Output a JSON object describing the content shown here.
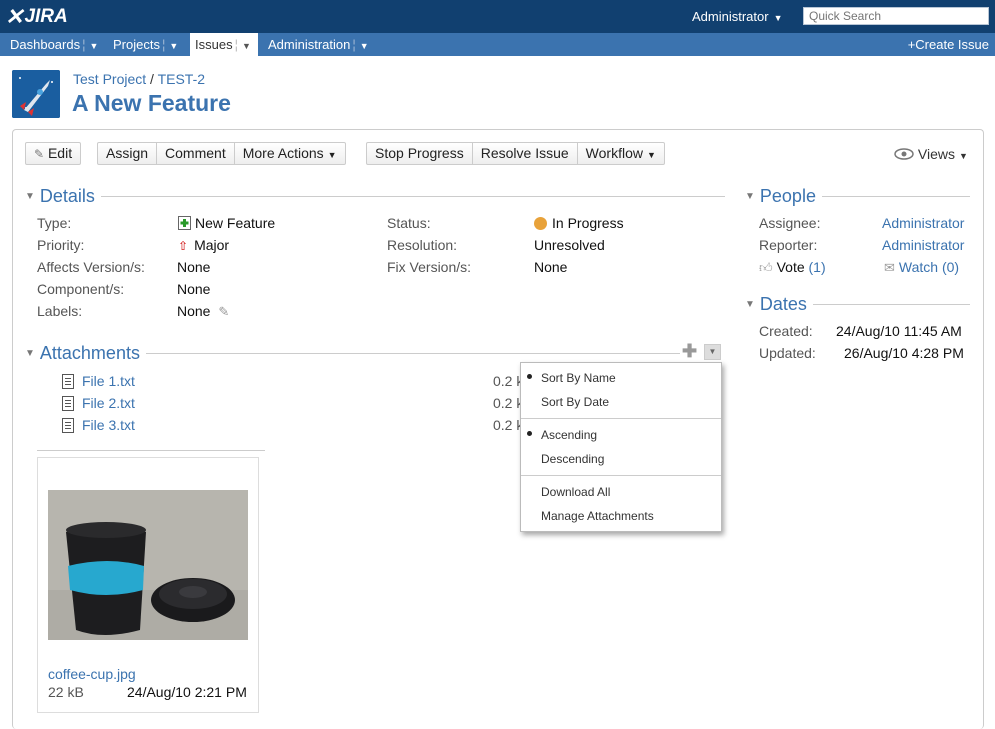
{
  "header": {
    "logo_text": "JIRA",
    "user_menu": "Administrator",
    "search_placeholder": "Quick Search"
  },
  "nav": {
    "items": [
      {
        "label": "Dashboards"
      },
      {
        "label": "Projects"
      },
      {
        "label": "Issues"
      },
      {
        "label": "Administration"
      }
    ],
    "create_issue": "Create Issue"
  },
  "issue": {
    "project": "Test Project",
    "key": "TEST-2",
    "title": "A New Feature"
  },
  "toolbar": {
    "edit": "Edit",
    "assign": "Assign",
    "comment": "Comment",
    "more_actions": "More Actions",
    "stop_progress": "Stop Progress",
    "resolve_issue": "Resolve Issue",
    "workflow": "Workflow",
    "views": "Views"
  },
  "details": {
    "title": "Details",
    "type_label": "Type:",
    "type_value": "New Feature",
    "priority_label": "Priority:",
    "priority_value": "Major",
    "affects_label": "Affects Version/s:",
    "affects_value": "None",
    "components_label": "Component/s:",
    "components_value": "None",
    "labels_label": "Labels:",
    "labels_value": "None",
    "status_label": "Status:",
    "status_value": "In Progress",
    "resolution_label": "Resolution:",
    "resolution_value": "Unresolved",
    "fix_label": "Fix Version/s:",
    "fix_value": "None"
  },
  "people": {
    "title": "People",
    "assignee_label": "Assignee:",
    "assignee_value": "Administrator",
    "reporter_label": "Reporter:",
    "reporter_value": "Administrator",
    "vote_label": "Vote",
    "vote_count": "(1)",
    "watch_label": "Watch",
    "watch_count": "(0)"
  },
  "dates": {
    "title": "Dates",
    "created_label": "Created:",
    "created_value": "24/Aug/10 11:45 AM",
    "updated_label": "Updated:",
    "updated_value": "26/Aug/10 4:28 PM"
  },
  "attachments": {
    "title": "Attachments",
    "files": [
      {
        "name": "File 1.txt",
        "size": "0.2 k"
      },
      {
        "name": "File 2.txt",
        "size": "0.2 k"
      },
      {
        "name": "File 3.txt",
        "size": "0.2 k"
      }
    ],
    "image": {
      "name": "coffee-cup.jpg",
      "size": "22 kB",
      "date": "24/Aug/10 2:21 PM"
    }
  },
  "attachment_menu": {
    "sort_by_name": "Sort By Name",
    "sort_by_date": "Sort By Date",
    "ascending": "Ascending",
    "descending": "Descending",
    "download_all": "Download All",
    "manage": "Manage Attachments"
  },
  "colors": {
    "header_bg": "#114070",
    "nav_bg": "#3b73af",
    "link": "#3b73af"
  }
}
